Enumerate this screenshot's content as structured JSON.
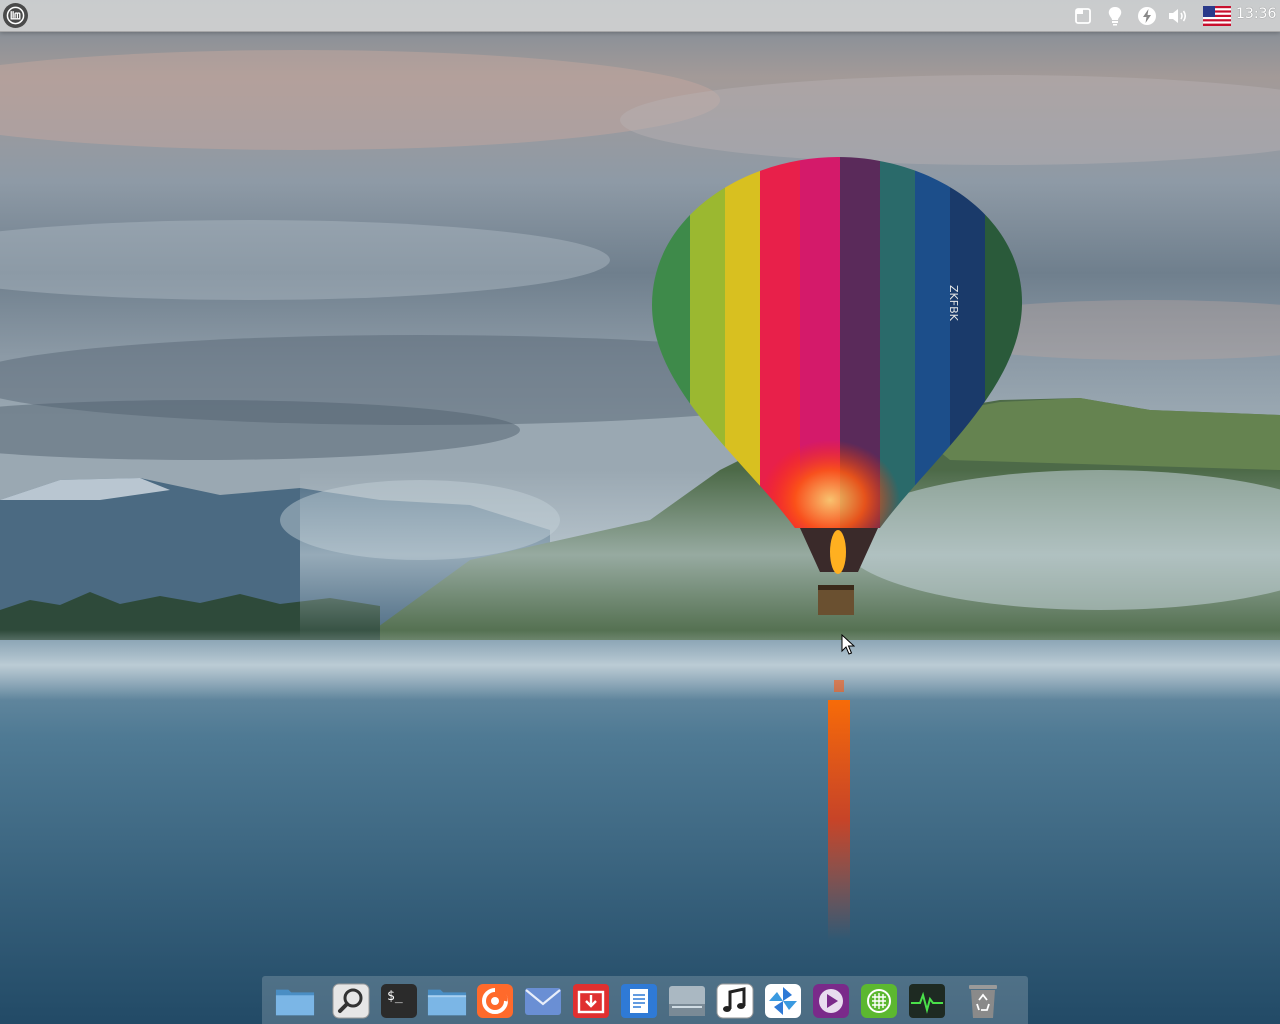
{
  "desktop": {
    "wallpaper": "hot-air-balloon-over-misty-lake",
    "balloon_registration": "ZKFBK"
  },
  "top_panel": {
    "menu_icon": "linux-mint-logo-icon",
    "tray": [
      {
        "name": "workspace-icon"
      },
      {
        "name": "lightbulb-icon"
      },
      {
        "name": "power-manager-icon"
      },
      {
        "name": "volume-icon"
      },
      {
        "name": "keyboard-layout-flag-icon"
      }
    ],
    "clock": "13:36"
  },
  "dock": {
    "items": [
      {
        "name": "files-home-folder-icon"
      },
      {
        "name": "search-icon"
      },
      {
        "name": "terminal-icon"
      },
      {
        "name": "file-manager-icon"
      },
      {
        "name": "firefox-icon"
      },
      {
        "name": "mail-icon"
      },
      {
        "name": "software-center-icon"
      },
      {
        "name": "text-editor-icon"
      },
      {
        "name": "disk-drive-icon"
      },
      {
        "name": "music-player-icon"
      },
      {
        "name": "settings-pinwheel-icon"
      },
      {
        "name": "video-player-icon"
      },
      {
        "name": "spreadsheet-icon"
      },
      {
        "name": "system-monitor-icon"
      },
      {
        "name": "trash-icon"
      }
    ]
  },
  "colors": {
    "panel": "#d6d6d6",
    "mint_green": "#87cf3e",
    "firefox_orange": "#ff6a2b",
    "terminal_dark": "#2b2b2b"
  }
}
